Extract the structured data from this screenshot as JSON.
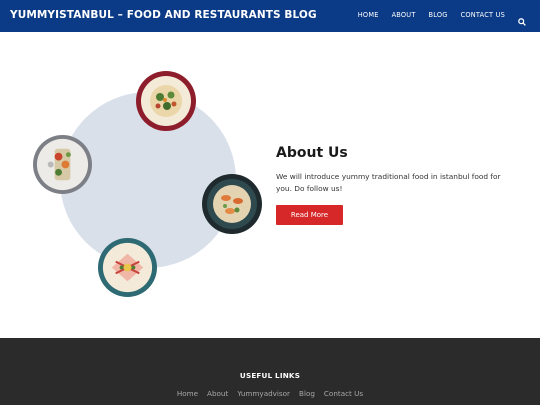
{
  "header": {
    "brand": "YUMMYISTANBUL – FOOD AND RESTAURANTS BLOG",
    "nav": [
      "HOME",
      "ABOUT",
      "BLOG",
      "CONTACT US"
    ],
    "search_icon": "search-icon"
  },
  "about": {
    "title": "About Us",
    "text": "We will introduce yummy traditional food in istanbul food for you. Do follow us!",
    "button": "Read More"
  },
  "footer": {
    "title": "USEFUL LINKS",
    "links": [
      "Home",
      "About",
      "Yummyadvisor",
      "Blog",
      "Contact Us"
    ]
  },
  "colors": {
    "header_bg": "#0b3b87",
    "accent": "#d62828",
    "footer_bg": "#2b2b2b",
    "circle_bg": "#d9e0ea"
  }
}
